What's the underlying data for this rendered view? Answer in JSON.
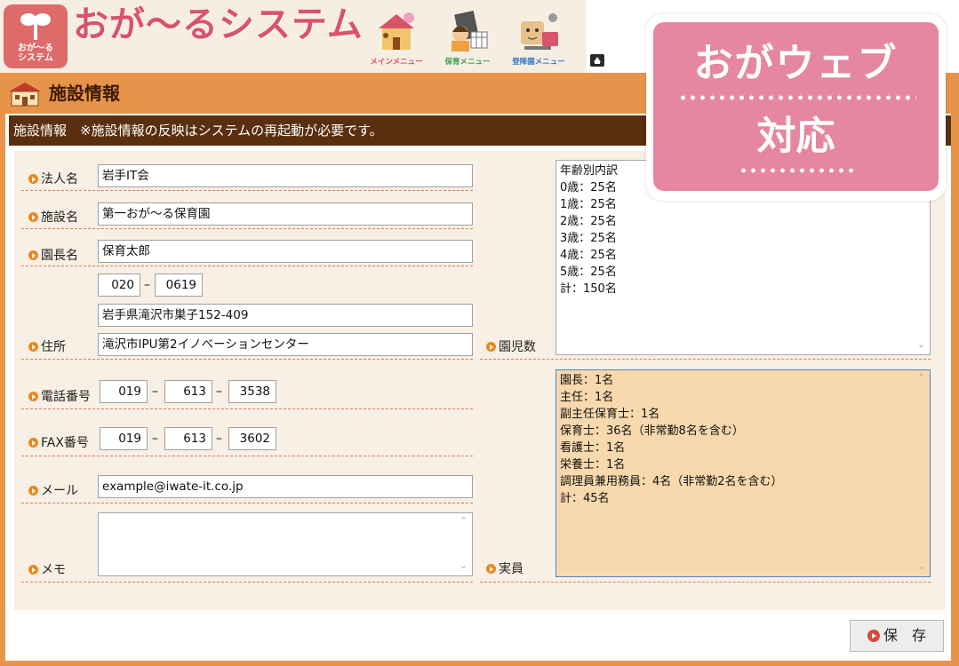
{
  "header": {
    "logo_text_line1": "おが〜る",
    "logo_text_line2": "システム",
    "app_title": "おが〜るシステム",
    "menus": [
      {
        "label": "メインメニュー",
        "color": "#d9536a"
      },
      {
        "label": "保育メニュー",
        "color": "#3aa04a"
      },
      {
        "label": "登降園メニュー",
        "color": "#3a78c8"
      }
    ]
  },
  "section": {
    "title": "施設情報"
  },
  "info_bar": {
    "text": "施設情報　※施設情報の反映はシステムの再起動が必要です。"
  },
  "form": {
    "corporation_label": "法人名",
    "corporation_value": "岩手IT会",
    "facility_label": "施設名",
    "facility_value": "第一おが〜る保育園",
    "director_label": "園長名",
    "director_value": "保育太郎",
    "address_label": "住所",
    "postal_1": "020",
    "postal_2": "0619",
    "address_1": "岩手県滝沢市巣子152-409",
    "address_2": "滝沢市IPU第2イノベーションセンター",
    "phone_label": "電話番号",
    "phone": [
      "019",
      "613",
      "3538"
    ],
    "fax_label": "FAX番号",
    "fax": [
      "019",
      "613",
      "3602"
    ],
    "email_label": "メール",
    "email_value": "example@iwate-it.co.jp",
    "memo_label": "メモ",
    "memo_value": "",
    "children_label": "園児数",
    "children_lines": [
      "年齢別内訳",
      "0歳：25名",
      "1歳：25名",
      "2歳：25名",
      "3歳：25名",
      "4歳：25名",
      "5歳：25名",
      "計：150名"
    ],
    "staff_label": "実員",
    "staff_lines": [
      "園長：1名",
      "主任：1名",
      "副主任保育士：1名",
      "保育士：36名（非常勤8名を含む）",
      "看護士：1名",
      "栄養士：1名",
      "調理員兼用務員：4名（非常勤2名を含む）",
      "計：45名"
    ],
    "dash_separator": "–"
  },
  "save_button": {
    "label": "保　存"
  },
  "badge": {
    "line1": "おがウェブ",
    "line2": "対応"
  },
  "colors": {
    "accent_orange": "#e8934a",
    "dark_brown": "#5a2f0f",
    "badge_pink": "#e587a0",
    "title_pink": "#d9536a"
  }
}
